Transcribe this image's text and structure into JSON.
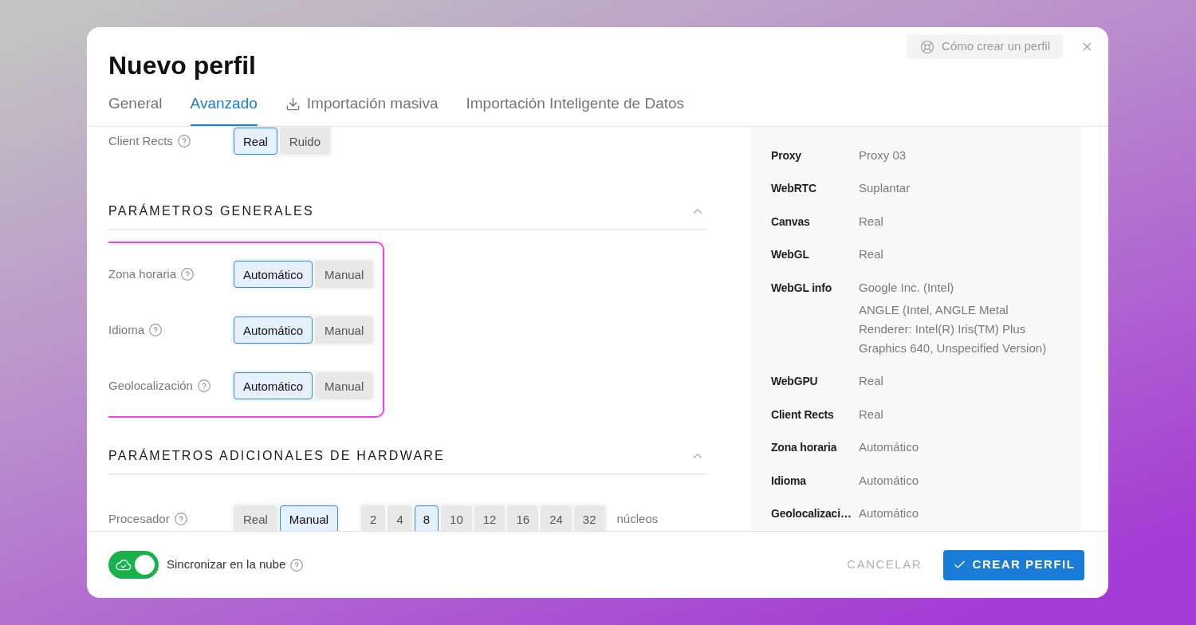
{
  "dialog": {
    "title": "Nuevo perfil",
    "help_button": "Cómo crear un perfil"
  },
  "tabs": [
    {
      "label": "General",
      "selected": false,
      "kind": "plain"
    },
    {
      "label": "Avanzado",
      "selected": true,
      "kind": "plain"
    },
    {
      "label": "Importación masiva",
      "selected": false,
      "kind": "download"
    },
    {
      "label": "Importación Inteligente de Datos",
      "selected": false,
      "kind": "plain"
    }
  ],
  "settings": {
    "previous_rows": [
      {
        "label": "Client Rects",
        "options": [
          {
            "label": "Real",
            "selected": true
          },
          {
            "label": "Ruido",
            "selected": false
          }
        ]
      }
    ],
    "sections": [
      {
        "title": "PARÁMETROS GENERALES",
        "expanded": true,
        "highlighted": true,
        "rows": [
          {
            "label": "Zona horaria",
            "options": [
              {
                "label": "Automático",
                "selected": true
              },
              {
                "label": "Manual",
                "selected": false
              }
            ]
          },
          {
            "label": "Idioma",
            "options": [
              {
                "label": "Automático",
                "selected": true
              },
              {
                "label": "Manual",
                "selected": false
              }
            ]
          },
          {
            "label": "Geolocalización",
            "options": [
              {
                "label": "Automático",
                "selected": true
              },
              {
                "label": "Manual",
                "selected": false
              }
            ]
          }
        ]
      },
      {
        "title": "PARÁMETROS ADICIONALES DE HARDWARE",
        "expanded": true,
        "highlighted": false,
        "rows": [
          {
            "label": "Procesador",
            "options": [
              {
                "label": "Real",
                "selected": false
              },
              {
                "label": "Manual",
                "selected": true
              }
            ],
            "counts": [
              {
                "label": "2",
                "selected": false
              },
              {
                "label": "4",
                "selected": false
              },
              {
                "label": "8",
                "selected": true
              },
              {
                "label": "10",
                "selected": false
              },
              {
                "label": "12",
                "selected": false
              },
              {
                "label": "16",
                "selected": false
              },
              {
                "label": "24",
                "selected": false
              },
              {
                "label": "32",
                "selected": false
              }
            ],
            "unit": "núcleos"
          }
        ]
      }
    ]
  },
  "summary": [
    {
      "label": "Proxy",
      "value": "Proxy 03"
    },
    {
      "label": "WebRTC",
      "value": "Suplantar"
    },
    {
      "label": "Canvas",
      "value": "Real"
    },
    {
      "label": "WebGL",
      "value": "Real"
    },
    {
      "label": "WebGL info",
      "value": "Google Inc. (Intel)",
      "detail": "ANGLE (Intel, ANGLE Metal Renderer: Intel(R) Iris(TM) Plus Graphics 640, Unspecified Version)"
    },
    {
      "label": "WebGPU",
      "value": "Real"
    },
    {
      "label": "Client Rects",
      "value": "Real"
    },
    {
      "label": "Zona horaria",
      "value": "Automático"
    },
    {
      "label": "Idioma",
      "value": "Automático"
    },
    {
      "label": "Geolocalizaci…",
      "value": "Automático"
    }
  ],
  "footer": {
    "cloud_sync": {
      "label": "Sincronizar en la nube",
      "on": true
    },
    "cancel_button": "CANCELAR",
    "create_button": "CREAR PERFIL"
  }
}
